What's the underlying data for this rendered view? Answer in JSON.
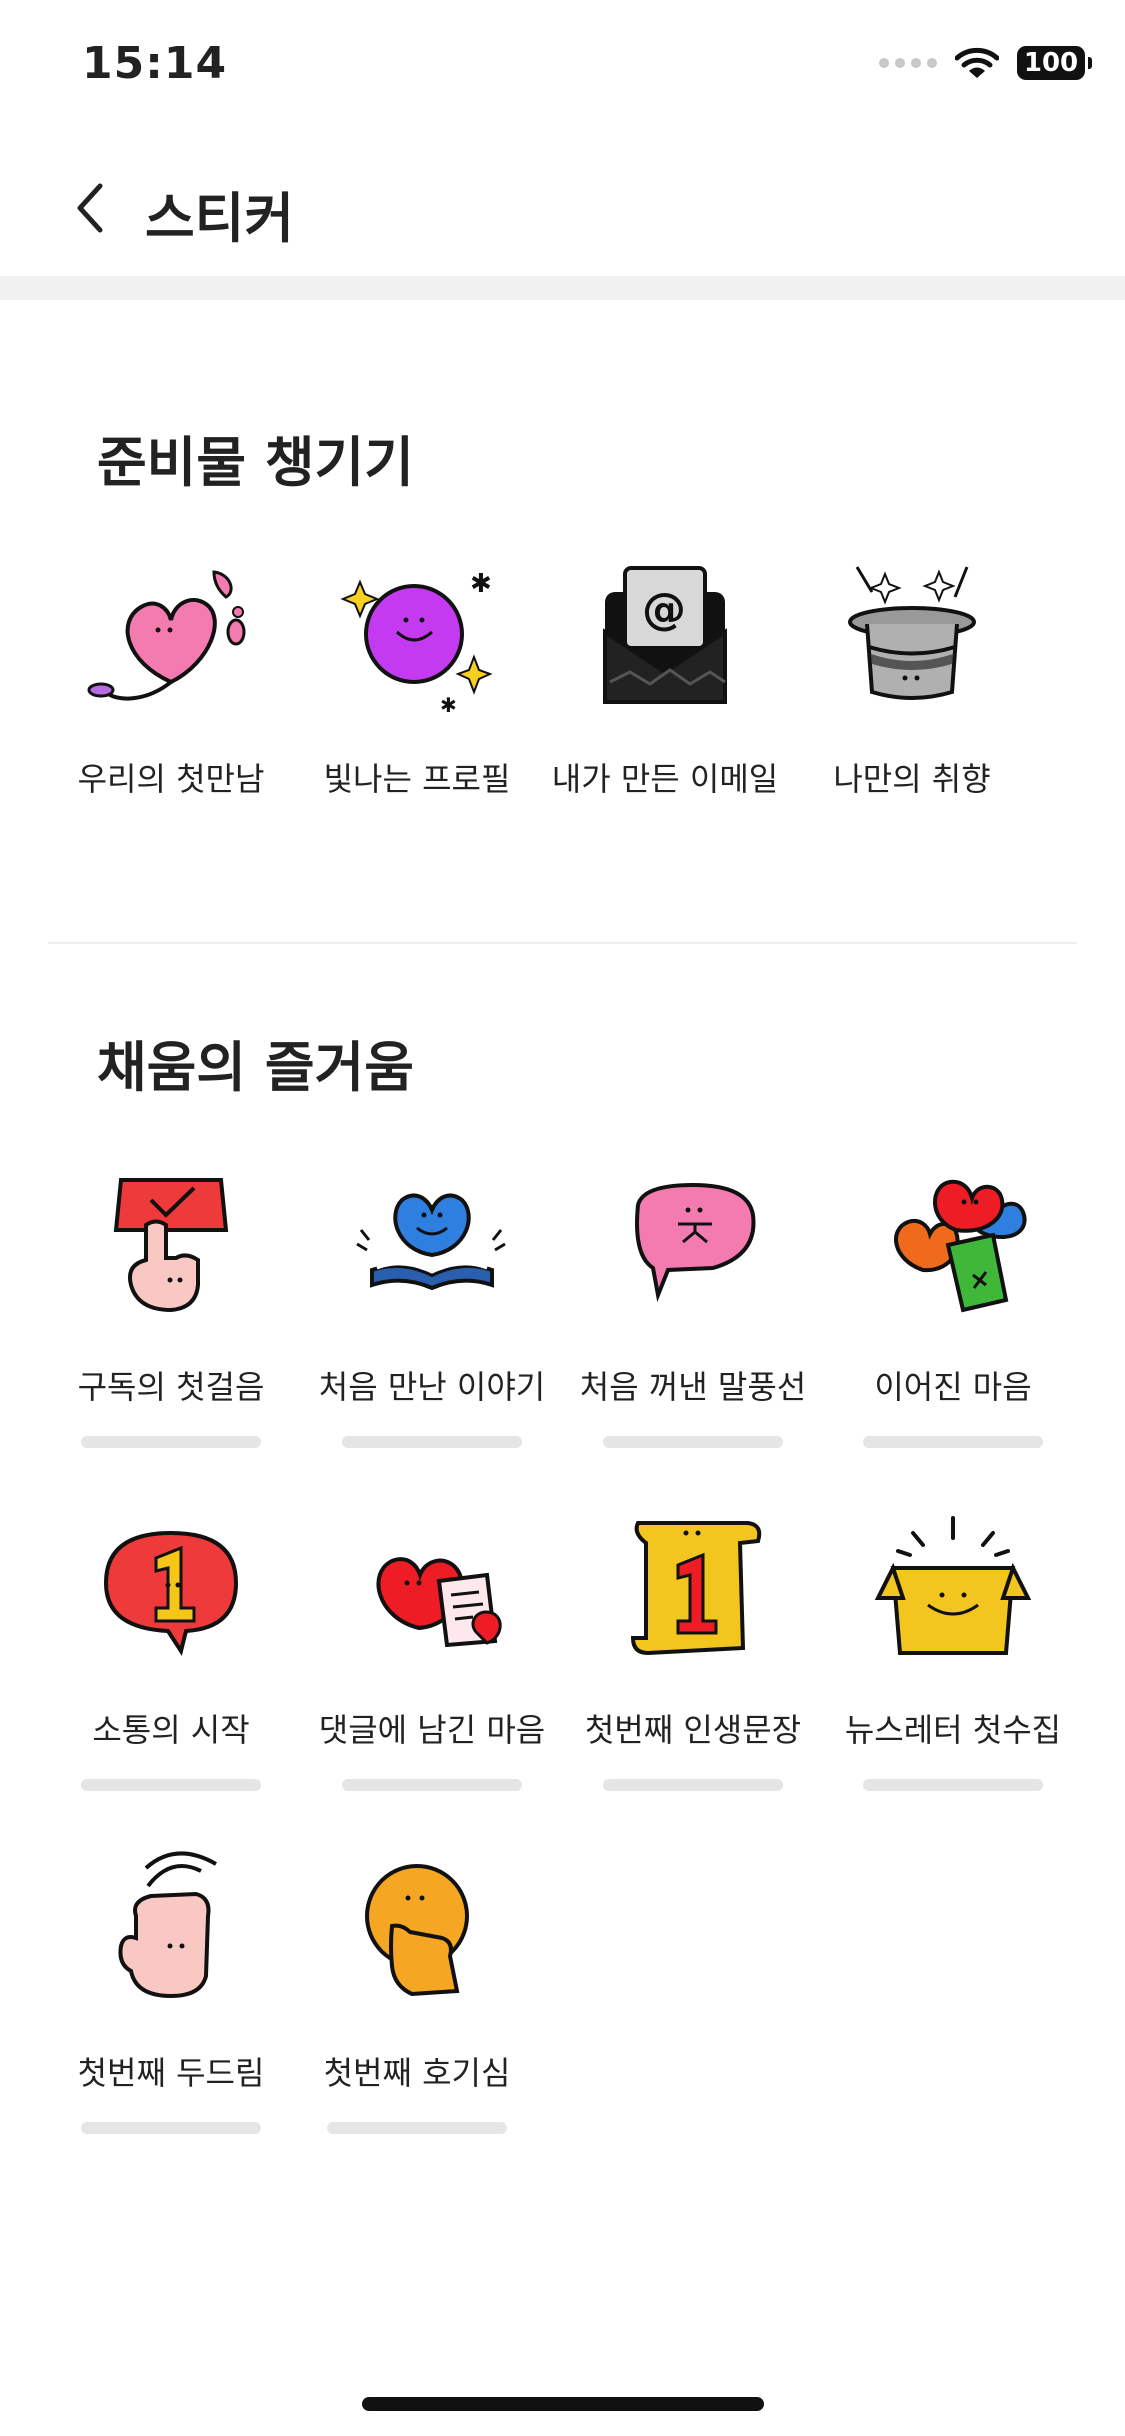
{
  "status": {
    "time": "15:14",
    "battery": "100"
  },
  "header": {
    "title": "스티커"
  },
  "sections": [
    {
      "title": "준비물 챙기기",
      "items": [
        {
          "label": "우리의 첫만남",
          "icon": "pink-heart-sticker-icon"
        },
        {
          "label": "빛나는 프로필",
          "icon": "purple-sparkle-ball-sticker-icon"
        },
        {
          "label": "내가 만든 이메일",
          "icon": "black-email-envelope-sticker-icon"
        },
        {
          "label": "나만의 취향",
          "icon": "magic-hat-sticker-icon"
        }
      ]
    },
    {
      "title": "채움의 즐거움",
      "items": [
        {
          "label": "구독의 첫걸음",
          "icon": "subscribe-button-finger-sticker-icon",
          "progress": 0
        },
        {
          "label": "처음 만난 이야기",
          "icon": "blue-heart-book-sticker-icon",
          "progress": 0
        },
        {
          "label": "처음 꺼낸 말풍선",
          "icon": "pink-speech-bubble-sticker-icon",
          "progress": 0
        },
        {
          "label": "이어진 마음",
          "icon": "colorful-hearts-sticker-icon",
          "progress": 0
        },
        {
          "label": "소통의 시작",
          "icon": "red-bubble-number-one-sticker-icon",
          "progress": 0
        },
        {
          "label": "댓글에 남긴 마음",
          "icon": "red-heart-note-sticker-icon",
          "progress": 0
        },
        {
          "label": "첫번째 인생문장",
          "icon": "yellow-scroll-number-one-sticker-icon",
          "progress": 0
        },
        {
          "label": "뉴스레터 첫수집",
          "icon": "yellow-box-sticker-icon",
          "progress": 0
        },
        {
          "label": "첫번째 두드림",
          "icon": "knocking-hand-sticker-icon",
          "progress": 0
        },
        {
          "label": "첫번째 호기심",
          "icon": "curious-yellow-face-sticker-icon",
          "progress": 0
        }
      ]
    }
  ],
  "colors": {
    "pink": "#f37bb0",
    "purple": "#c43af0",
    "red": "#ee3a3a",
    "blue": "#2f7fe0",
    "yellow": "#f2c61f",
    "orange": "#f5a623",
    "skin": "#f9c8c3",
    "gray": "#a8a8a8",
    "green": "#3fb83a"
  }
}
